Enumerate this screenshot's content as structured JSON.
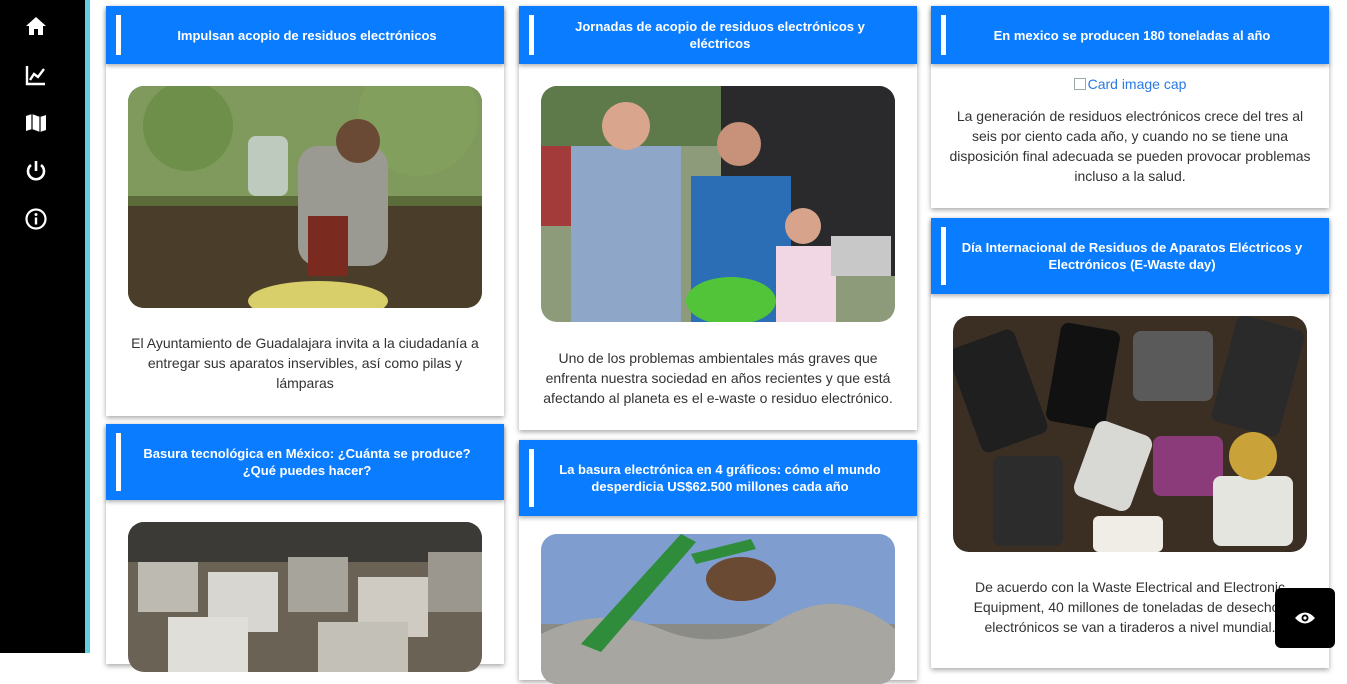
{
  "sidebar": {
    "items": [
      {
        "icon": "home-icon"
      },
      {
        "icon": "chart-line-icon"
      },
      {
        "icon": "map-icon"
      },
      {
        "icon": "power-icon"
      },
      {
        "icon": "info-icon"
      }
    ]
  },
  "cards": [
    {
      "title": "Impulsan acopio de residuos electrónicos",
      "text": "El Ayuntamiento de Guadalajara invita a la ciudadanía a entregar sus aparatos inservibles, así como pilas y lámparas"
    },
    {
      "title": "Basura tecnológica en México: ¿Cuánta se produce? ¿Qué puedes hacer?"
    },
    {
      "title": "Jornadas de acopio de residuos electrónicos y eléctricos",
      "text": "Uno de los problemas ambientales más graves que enfrenta nuestra sociedad en años recientes y que está afectando al planeta es el e-waste o residuo electrónico."
    },
    {
      "title": "La basura electrónica en 4 gráficos: cómo el mundo desperdicia US$62.500 millones cada año"
    },
    {
      "title": "En mexico se producen 180 toneladas al año",
      "image_alt": "Card image cap",
      "text": "La generación de residuos electrónicos crece del tres al seis por ciento cada año, y cuando no se tiene una disposición final adecuada se pueden provocar problemas incluso a la salud."
    },
    {
      "title": "Día Internacional de Residuos de Aparatos Eléctricos y Electrónicos (E-Waste day)",
      "text": "De acuerdo con la Waste Electrical and Electronic Equipment, 40 millones de toneladas de desechos electrónicos se van a tiraderos a nivel mundial."
    }
  ],
  "colors": {
    "header": "#0a7cff",
    "sidebar": "#000000",
    "accent": "#5fcfe0"
  }
}
